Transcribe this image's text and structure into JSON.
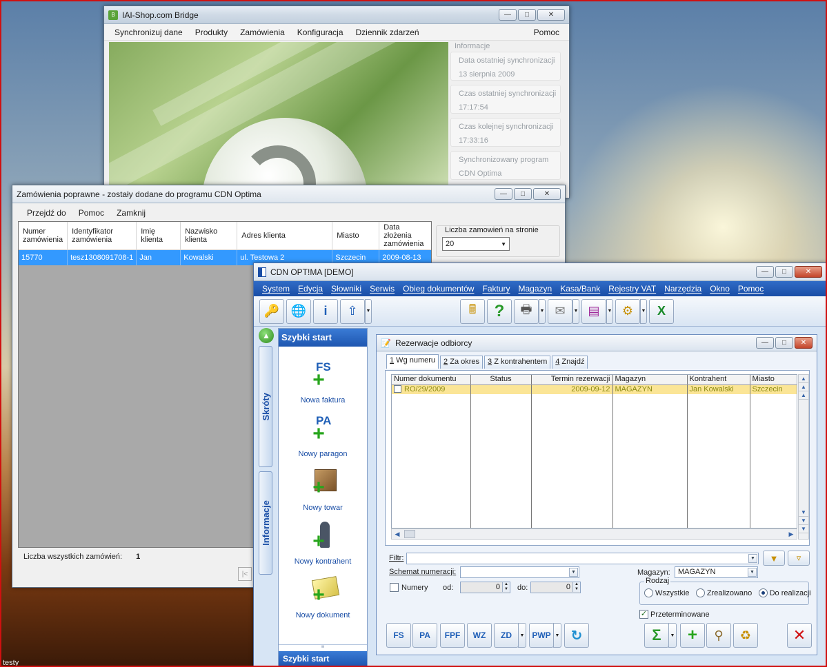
{
  "desktop": {
    "bottom_label": "testy"
  },
  "bridge": {
    "title": "IAI-Shop.com Bridge",
    "menu": [
      "Synchronizuj dane",
      "Produkty",
      "Zamówienia",
      "Konfiguracja",
      "Dziennik zdarzeń"
    ],
    "menu_right": "Pomoc",
    "info_label": "Informacje",
    "info": [
      {
        "label": "Data ostatniej synchronizacji",
        "value": "13 sierpnia 2009"
      },
      {
        "label": "Czas ostatniej synchronizacji",
        "value": "17:17:54"
      },
      {
        "label": "Czas kolejnej synchronizacji",
        "value": "17:33:16"
      },
      {
        "label": "Synchronizowany program",
        "value": "CDN Optima"
      }
    ]
  },
  "orders": {
    "title": "Zamówienia poprawne - zostały dodane do programu CDN Optima",
    "menu": [
      "Przejdź do",
      "Pomoc",
      "Zamknij"
    ],
    "columns": [
      "Numer zamówienia",
      "Identyfikator zamówienia",
      "Imię klienta",
      "Nazwisko klienta",
      "Adres klienta",
      "Miasto",
      "Data złożenia zamówienia"
    ],
    "rows": [
      [
        "15770",
        "tesz1308091708-1",
        "Jan",
        "Kowalski",
        "ul. Testowa 2",
        "Szczecin",
        "2009-08-13"
      ]
    ],
    "per_page_label": "Liczba zamowień na stronie",
    "per_page_value": "20",
    "total_label": "Liczba wszystkich zamówień:",
    "total_value": "1",
    "pager_first": "|<"
  },
  "optima": {
    "title": "CDN OPT!MA [DEMO]",
    "menu": [
      "System",
      "Edycja",
      "Słowniki",
      "Serwis",
      "Obieg dokumentów",
      "Faktury",
      "Magazyn",
      "Kasa/Bank",
      "Rejestry VAT",
      "Narzędzia",
      "Okno",
      "Pomoc"
    ],
    "side_tabs": [
      "Skróty",
      "Informacje"
    ],
    "quick_start": {
      "title": "Szybki start",
      "footer": "Szybki start",
      "items": [
        {
          "label": "Nowa faktura",
          "letters": "FS"
        },
        {
          "label": "Nowy paragon",
          "letters": "PA"
        },
        {
          "label": "Nowy towar",
          "letters": ""
        },
        {
          "label": "Nowy kontrahent",
          "letters": ""
        },
        {
          "label": "Nowy dokument",
          "letters": ""
        }
      ]
    },
    "rez": {
      "title": "Rezerwacje odbiorcy",
      "tabs": [
        {
          "num": "1",
          "label": " Wg numeru"
        },
        {
          "num": "2",
          "label": " Za okres"
        },
        {
          "num": "3",
          "label": " Z kontrahentem"
        },
        {
          "num": "4",
          "label": " Znajdź"
        }
      ],
      "columns": [
        "Numer dokumentu",
        "Status",
        "Termin rezerwacji",
        "Magazyn",
        "Kontrahent",
        "Miasto"
      ],
      "rows": [
        {
          "number": "RO/29/2009",
          "status": "",
          "date": "2009-09-12",
          "warehouse": "MAGAZYN",
          "contractor": "Jan Kowalski",
          "city": "Szczecin"
        }
      ],
      "filter_label": "Filtr:",
      "filter_value": "",
      "schema_label": "Schemat numeracji:",
      "schema_value": "",
      "warehouse_label": "Magazyn:",
      "warehouse_value": "MAGAZYN",
      "numbers_label": "Numery",
      "from_label": "od:",
      "from_value": "0",
      "to_label": "do:",
      "to_value": "0",
      "kind_label": "Rodzaj",
      "kind_options": [
        "Wszystkie",
        "Zrealizowano",
        "Do realizacji"
      ],
      "kind_selected": "Do realizacji",
      "overdue_label": "Przeterminowane",
      "overdue_checked": true,
      "doc_buttons": [
        "FS",
        "PA",
        "FPF",
        "WZ",
        "ZD",
        "PWP"
      ]
    }
  }
}
